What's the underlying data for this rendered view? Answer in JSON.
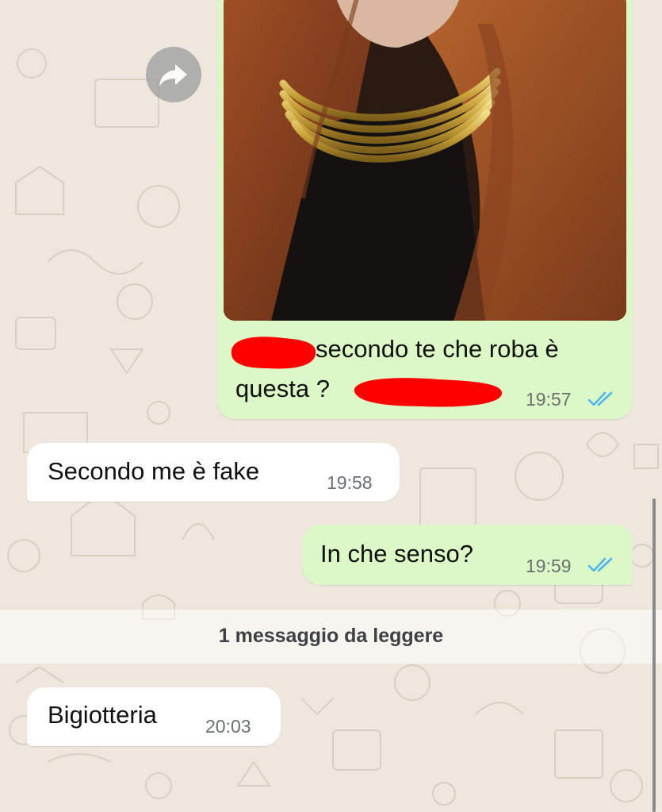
{
  "colors": {
    "outgoing_bubble": "#dcf8c6",
    "incoming_bubble": "#ffffff",
    "read_ticks": "#4fb6ec",
    "redaction": "#ff0000",
    "wallpaper": "#efe7dd"
  },
  "messages": [
    {
      "direction": "outgoing",
      "type": "image",
      "image": "photo of woman with long auburn hair wearing gold choker necklace",
      "caption_line1": "secondo te che roba è",
      "caption_line2": "questa ?",
      "time": "19:57",
      "status": "read",
      "redacted": true
    },
    {
      "direction": "incoming",
      "text": "Secondo me è fake",
      "time": "19:58"
    },
    {
      "direction": "outgoing",
      "text": "In che senso?",
      "time": "19:59",
      "status": "read"
    },
    {
      "direction": "incoming",
      "text": "Bigiotteria",
      "time": "20:03"
    }
  ],
  "unread_banner": "1 messaggio da leggere",
  "icons": {
    "forward": "forward-arrow-icon",
    "read_receipt": "double-check-icon"
  }
}
